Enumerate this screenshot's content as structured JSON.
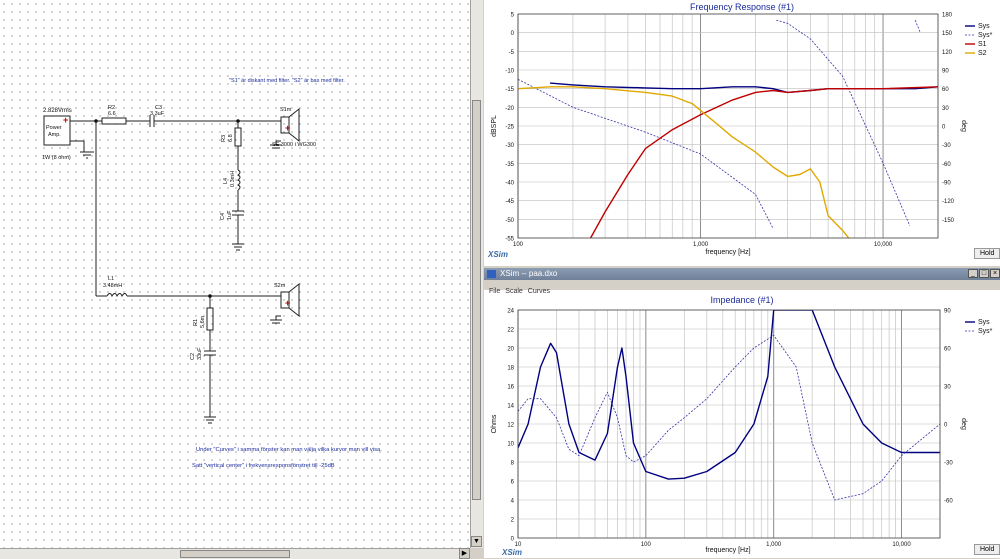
{
  "schematic": {
    "note_top": "\"S1\" är diskant med filter. \"S2\" är bas med filter.",
    "note_bottom1": "Under \"Curves\" i samma fönster kan man välja vilka kurvor man vill visa.",
    "note_bottom2": "Satt \"vertical center\" i frekvensresponsfönstret till -25dB",
    "source_voltage": "2.828Vrms",
    "source_label1": "Power",
    "source_label2": "Amp.",
    "source_power": "1W (8 ohm)",
    "r2_name": "R2",
    "r2_value": "6.6",
    "c3_name": "C3",
    "c3_value": "3.3uF",
    "s1_name": "S1m",
    "s1_model": "SE 3000 i WG300",
    "r3_name": "R3",
    "r3_value": "6.8",
    "l4_name": "L4",
    "l4_value": "0.3mH",
    "c4_name": "C4",
    "c4_value": "1uF",
    "l1_name": "L1",
    "l1_value": "3.48mH",
    "s2_name": "S2m",
    "r1_name": "R1",
    "r1_value": "5.6m",
    "c2_name": "C2",
    "c2_value": "33uF"
  },
  "freq_response": {
    "title": "Frequency Response (#1)",
    "ylabel_left": "dBSPL",
    "ylabel_right": "deg",
    "xlabel": "frequency [Hz]",
    "brand": "XSim",
    "hold": "Hold",
    "legend": [
      {
        "name": "Sys",
        "color": "#000080",
        "dash": false
      },
      {
        "name": "Sys*",
        "color": "#3333aa",
        "dash": true
      },
      {
        "name": "S1",
        "color": "#c00000",
        "dash": false
      },
      {
        "name": "S2",
        "color": "#e0a800",
        "dash": false
      }
    ],
    "y_ticks": [
      "5",
      "0",
      "-5",
      "-10",
      "-15",
      "-20",
      "-25",
      "-30",
      "-35",
      "-40",
      "-45",
      "-50",
      "-55"
    ],
    "y2_ticks": [
      "180",
      "150",
      "120",
      "90",
      "60",
      "30",
      "0",
      "-30",
      "-60",
      "-90",
      "-120",
      "-150"
    ],
    "x_ticks": [
      "100",
      "1,000",
      "10,000"
    ]
  },
  "impedance_window": {
    "window_title": "XSim -- paa.dxo",
    "menu": [
      "File",
      "Scale",
      "Curves"
    ],
    "title": "Impedance (#1)",
    "ylabel_left": "Ohms",
    "ylabel_right": "deg",
    "xlabel": "frequency [Hz]",
    "brand": "XSim",
    "hold": "Hold",
    "legend": [
      {
        "name": "Sys",
        "color": "#000080",
        "dash": false
      },
      {
        "name": "Sys*",
        "color": "#3333aa",
        "dash": true
      }
    ],
    "y_ticks": [
      "24",
      "22",
      "20",
      "18",
      "16",
      "14",
      "12",
      "10",
      "8",
      "6",
      "4",
      "2",
      "0"
    ],
    "y2_ticks": [
      "90",
      "60",
      "30",
      "0",
      "-30",
      "-60"
    ],
    "x_ticks": [
      "10",
      "100",
      "1,000",
      "10,000"
    ]
  },
  "chart_data": [
    {
      "type": "line",
      "title": "Frequency Response (#1)",
      "xlabel": "frequency [Hz]",
      "ylabel": "dBSPL",
      "y2label": "deg",
      "xscale": "log",
      "xlim": [
        100,
        20000
      ],
      "ylim": [
        -55,
        5
      ],
      "y2lim": [
        -180,
        180
      ],
      "grid": true,
      "legend": "right",
      "series": [
        {
          "name": "Sys",
          "axis": "left",
          "x": [
            150,
            200,
            300,
            500,
            700,
            1000,
            1500,
            2000,
            2500,
            3000,
            4000,
            5000,
            7000,
            10000,
            15000,
            20000
          ],
          "y": [
            -13.5,
            -14,
            -14.5,
            -14.8,
            -15,
            -15,
            -14.5,
            -14.5,
            -15,
            -16,
            -15.5,
            -15,
            -15,
            -15,
            -15,
            -14.5
          ]
        },
        {
          "name": "Sys*",
          "axis": "right",
          "x": [
            100,
            200,
            500,
            1000,
            2000,
            2500,
            2600,
            3000,
            4000,
            6000,
            10000,
            14000,
            15000,
            16000,
            20000
          ],
          "y": [
            75,
            30,
            -10,
            -45,
            -110,
            -165,
            170,
            165,
            140,
            80,
            -60,
            -160,
            170,
            150,
            -60
          ]
        },
        {
          "name": "S1",
          "axis": "left",
          "x": [
            250,
            300,
            400,
            500,
            700,
            1000,
            1500,
            2000,
            2500,
            3000,
            4000,
            5000,
            10000,
            20000
          ],
          "y": [
            -55,
            -48,
            -38,
            -31,
            -26,
            -22,
            -18,
            -16,
            -15.5,
            -16,
            -15.5,
            -15,
            -15,
            -14.5
          ]
        },
        {
          "name": "S2",
          "axis": "left",
          "x": [
            100,
            150,
            200,
            300,
            500,
            700,
            900,
            1200,
            1500,
            2000,
            2500,
            3000,
            3500,
            4000,
            4500,
            5000,
            6000,
            7000
          ],
          "y": [
            -15,
            -14.5,
            -14.5,
            -15,
            -16,
            -17,
            -19,
            -24,
            -28,
            -32,
            -36,
            -38.5,
            -38,
            -36.5,
            -40,
            -49,
            -53,
            -57
          ]
        }
      ]
    },
    {
      "type": "line",
      "title": "Impedance (#1)",
      "xlabel": "frequency [Hz]",
      "ylabel": "Ohms",
      "y2label": "deg",
      "xscale": "log",
      "xlim": [
        10,
        20000
      ],
      "ylim": [
        0,
        24
      ],
      "y2lim": [
        -90,
        90
      ],
      "grid": true,
      "legend": "right",
      "series": [
        {
          "name": "Sys",
          "axis": "left",
          "x": [
            10,
            12,
            15,
            18,
            20,
            25,
            30,
            40,
            50,
            60,
            65,
            70,
            80,
            100,
            150,
            200,
            300,
            500,
            700,
            900,
            1000,
            1500,
            2000,
            3000,
            5000,
            7000,
            10000,
            20000
          ],
          "y": [
            9.5,
            12,
            18,
            20.5,
            19.5,
            12,
            9,
            8.2,
            11,
            18,
            20,
            17,
            10,
            7,
            6.2,
            6.3,
            7,
            9,
            12,
            17,
            24,
            24,
            24,
            18,
            12,
            10,
            9,
            9
          ]
        },
        {
          "name": "Sys*",
          "axis": "right",
          "x": [
            10,
            12,
            15,
            20,
            25,
            30,
            40,
            50,
            60,
            70,
            80,
            100,
            150,
            200,
            300,
            500,
            700,
            1000,
            1500,
            2000,
            3000,
            5000,
            7000,
            10000,
            20000
          ],
          "y": [
            10,
            20,
            20,
            5,
            -20,
            -25,
            5,
            25,
            5,
            -25,
            -30,
            -25,
            -5,
            5,
            20,
            45,
            60,
            70,
            45,
            -15,
            -60,
            -55,
            -45,
            -25,
            0
          ]
        }
      ]
    }
  ]
}
